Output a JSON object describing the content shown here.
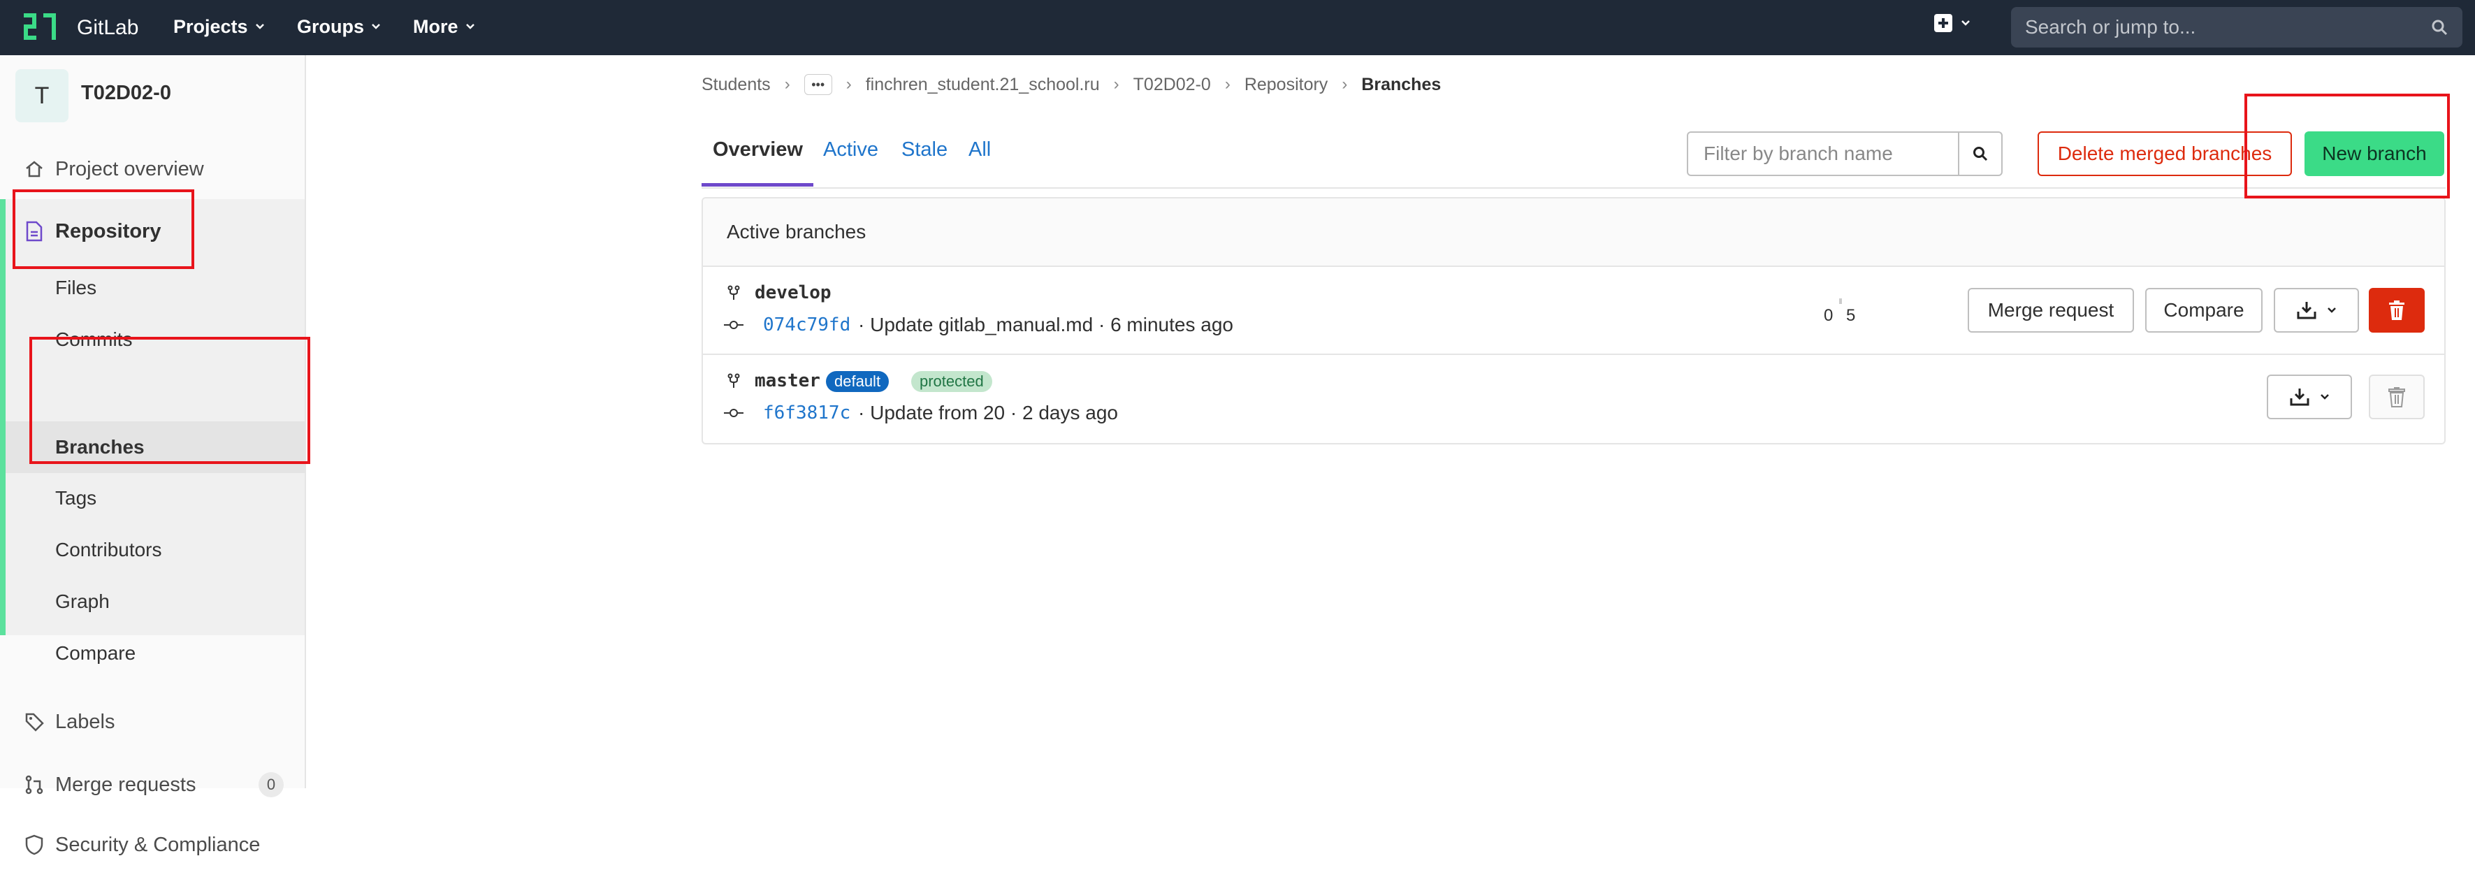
{
  "navbar": {
    "brand": "GitLab",
    "menus": [
      "Projects",
      "Groups",
      "More"
    ],
    "search_placeholder": "Search or jump to..."
  },
  "sidebar": {
    "avatar_letter": "T",
    "project_name": "T02D02-0",
    "items": {
      "project_overview": "Project overview",
      "repository": "Repository",
      "labels": "Labels",
      "merge_requests": "Merge requests",
      "merge_requests_count": "0",
      "security": "Security & Compliance"
    },
    "repository_sub": [
      "Files",
      "Commits",
      "Branches",
      "Tags",
      "Contributors",
      "Graph",
      "Compare"
    ]
  },
  "breadcrumb": {
    "items": [
      "Students",
      "finchren_student.21_school.ru",
      "T02D02-0",
      "Repository",
      "Branches"
    ],
    "ellipsis": "•••"
  },
  "tabs": [
    "Overview",
    "Active",
    "Stale",
    "All"
  ],
  "filter": {
    "placeholder": "Filter by branch name"
  },
  "buttons": {
    "delete_merged": "Delete merged branches",
    "new_branch": "New branch",
    "merge_request": "Merge request",
    "compare": "Compare"
  },
  "panel": {
    "title": "Active branches",
    "branches": [
      {
        "name": "develop",
        "sha": "074c79fd",
        "message": "· Update gitlab_manual.md · 6 minutes ago",
        "behind": "0",
        "ahead": "5"
      },
      {
        "name": "master",
        "badge_default": "default",
        "badge_protected": "protected",
        "sha": "f6f3817c",
        "message": "· Update from 20 · 2 days ago"
      }
    ]
  },
  "colors": {
    "navbar": "#1f2937",
    "accent_green": "#3bdb87",
    "danger": "#dd2b0e",
    "link": "#1f75cb",
    "tab_underline": "#6e49cb",
    "annotation": "#e8141b"
  }
}
